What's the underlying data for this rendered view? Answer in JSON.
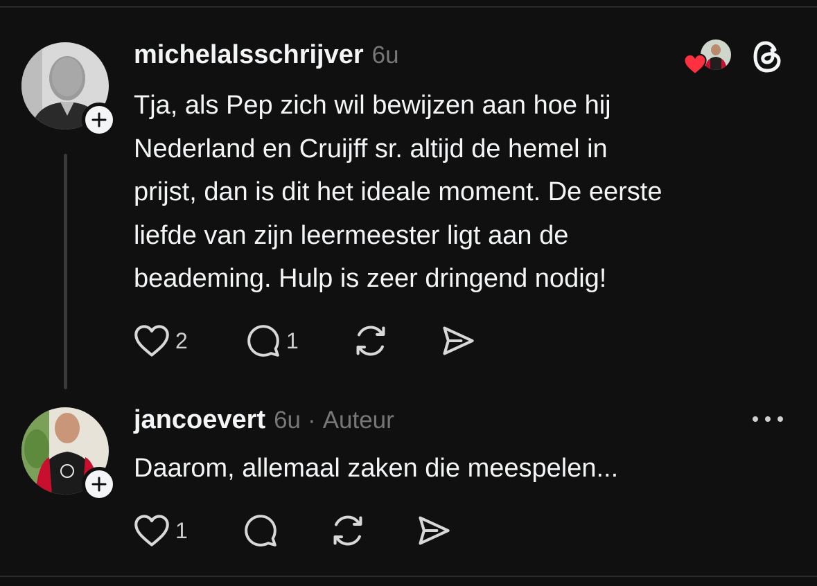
{
  "post": {
    "username": "michelalsschrijver",
    "time": "6u",
    "lines": [
      "Tja, als Pep zich wil bewijzen aan hoe hij",
      "Nederland en Cruijff sr. altijd de hemel in",
      "prijst, dan is dit het ideale moment. De eerste",
      "liefde van zijn leermeester ligt aan de",
      "beademing. Hulp is zeer dringend nodig!"
    ],
    "likes": "2",
    "replies": "1",
    "icons": [
      "heart-icon",
      "comment-icon",
      "repost-icon",
      "share-icon",
      "threads-logo-icon",
      "plus-icon"
    ]
  },
  "reply": {
    "username": "jancoevert",
    "time": "6u",
    "separator": "·",
    "author_badge": "Auteur",
    "text": "Daarom, allemaal zaken die meespelen...",
    "likes": "1",
    "icons": [
      "heart-icon",
      "comment-icon",
      "repost-icon",
      "share-icon",
      "more-icon",
      "plus-icon"
    ]
  },
  "colors": {
    "background": "#101010",
    "text": "#f3f5f7",
    "muted": "#777777",
    "like_red": "#ff3040"
  }
}
